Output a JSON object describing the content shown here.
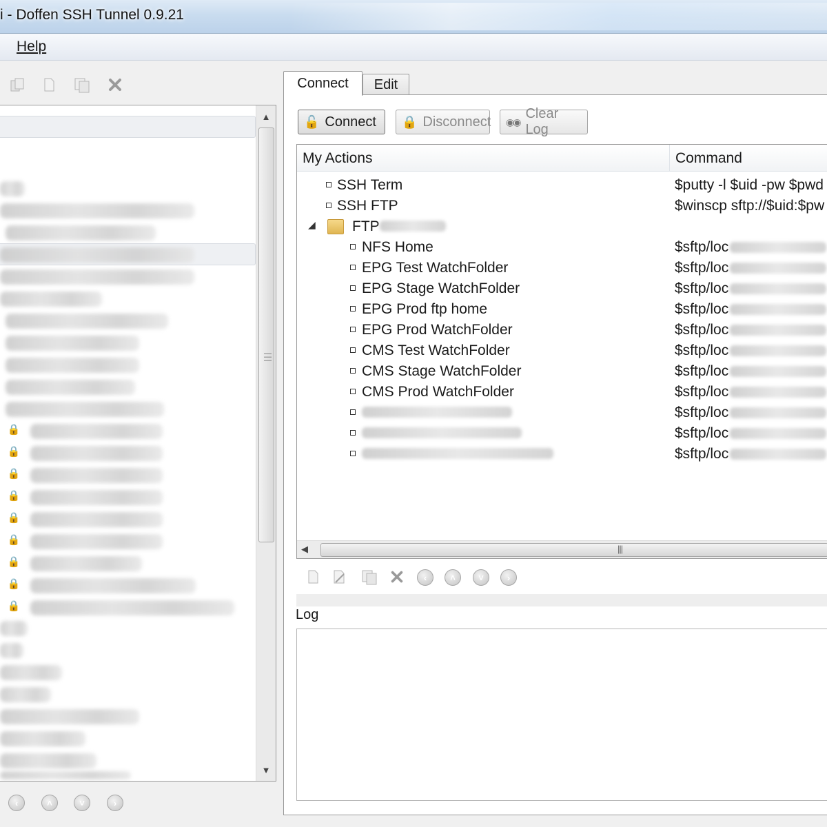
{
  "window": {
    "title": "i - Doffen SSH Tunnel 0.9.21"
  },
  "menu": {
    "help_label": "Help"
  },
  "tabs": [
    {
      "label": "Connect",
      "active": true
    },
    {
      "label": "Edit",
      "active": false
    }
  ],
  "buttons": {
    "connect": "Connect",
    "disconnect": "Disconnect",
    "clear_log": "Clear Log"
  },
  "actions_table": {
    "columns": [
      "My Actions",
      "Command"
    ],
    "rows": [
      {
        "name": "SSH Term",
        "command": "$putty -l $uid -pw $pwd"
      },
      {
        "name": "SSH FTP",
        "command": "$winscp sftp://$uid:$pw"
      },
      {
        "name": "FTP",
        "command": "",
        "folder": true,
        "expanded": true
      },
      {
        "name": "NFS Home",
        "command": "$sftp/loc"
      },
      {
        "name": "EPG Test WatchFolder",
        "command": "$sftp/loc"
      },
      {
        "name": "EPG Stage WatchFolder",
        "command": "$sftp/loc"
      },
      {
        "name": "EPG Prod ftp home",
        "command": "$sftp/loc"
      },
      {
        "name": "EPG Prod WatchFolder",
        "command": "$sftp/loc"
      },
      {
        "name": "CMS Test WatchFolder",
        "command": "$sftp/loc"
      },
      {
        "name": "CMS Stage WatchFolder",
        "command": "$sftp/loc"
      },
      {
        "name": "CMS Prod WatchFolder",
        "command": "$sftp/loc"
      },
      {
        "name": "",
        "command": "$sftp/loc"
      },
      {
        "name": "",
        "command": "$sftp/loc"
      },
      {
        "name": "",
        "command": "$sftp/loc"
      }
    ]
  },
  "log": {
    "label": "Log"
  },
  "icons": {
    "toolbar_left": [
      "copy-icon",
      "new-icon",
      "duplicate-icon",
      "delete-icon"
    ],
    "toolbar_actions": [
      "new-icon",
      "edit-icon",
      "duplicate-icon",
      "delete-icon",
      "arrow-left-icon",
      "arrow-up-icon",
      "arrow-down-icon",
      "arrow-right-icon"
    ],
    "nav_left": [
      "arrow-left-icon",
      "arrow-up-icon",
      "arrow-down-icon",
      "arrow-right-icon"
    ]
  },
  "colors": {
    "titlebar": "#c9dcef",
    "accent_lock": "#c9a100",
    "folder": "#e0b652"
  }
}
